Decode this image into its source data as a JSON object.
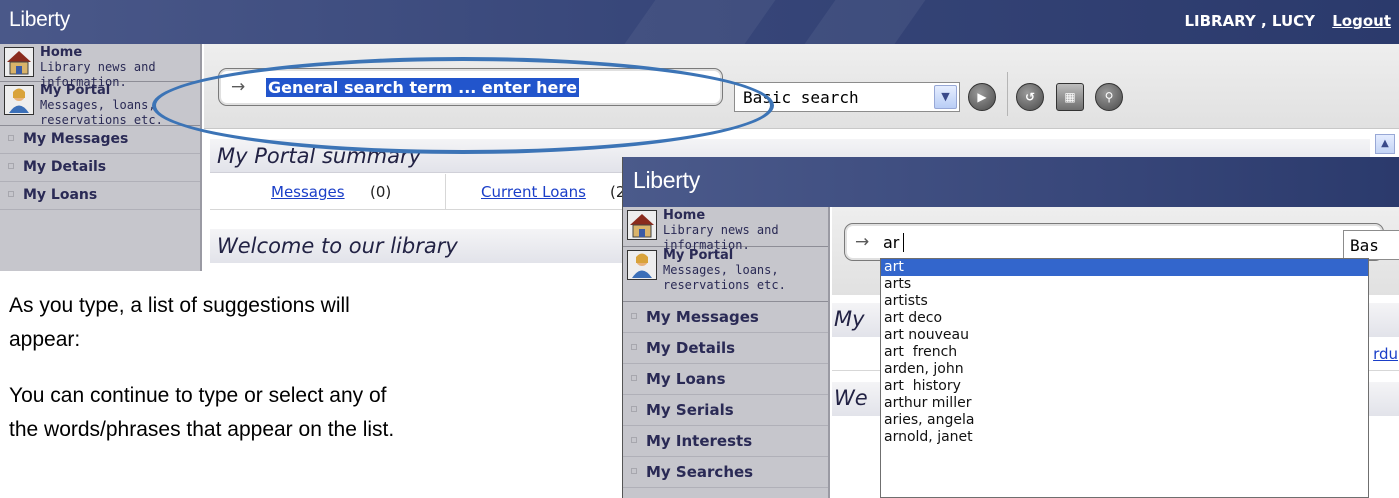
{
  "screenshot1": {
    "app_name": "Liberty",
    "user_name": "LIBRARY , LUCY",
    "logout_label": "Logout",
    "nav": {
      "home_title": "Home",
      "home_desc": "Library news and information.",
      "portal_title": "My Portal",
      "portal_desc": "Messages, loans, reservations etc.",
      "items": [
        "My Messages",
        "My Details",
        "My Loans"
      ]
    },
    "search": {
      "arrow": "→",
      "value": "General search term ... enter here",
      "search_type": "Basic search"
    },
    "toolbar_icons": [
      "go-button",
      "reset-button",
      "clear-button",
      "zoom-button"
    ],
    "summary_title": "My Portal summary",
    "summary_links": [
      {
        "label": "Messages",
        "count": "(0)"
      },
      {
        "label": "Current Loans",
        "count": "(2"
      }
    ],
    "welcome_title": "Welcome to our library"
  },
  "instructions": {
    "line1": "As you type, a list of suggestions will",
    "line2": "appear:",
    "line3": "You can continue to type or select any of",
    "line4": "the words/phrases that appear on the list."
  },
  "screenshot2": {
    "app_name": "Liberty",
    "nav": {
      "home_title": "Home",
      "home_desc": "Library news and information.",
      "portal_title": "My Portal",
      "portal_desc": "Messages, loans, reservations etc.",
      "items": [
        "My Messages",
        "My Details",
        "My Loans",
        "My Serials",
        "My Interests",
        "My Searches"
      ]
    },
    "search": {
      "arrow": "→",
      "value": "ar",
      "search_type_partial": "Bas"
    },
    "content_partial": {
      "heading1": "My",
      "link_partial": "rdu",
      "heading2": "We"
    },
    "suggestions": [
      "art",
      "arts",
      "artists",
      "art deco",
      "art nouveau",
      "art  french",
      "arden, john",
      "art  history",
      "arthur miller",
      "aries, angela",
      "arnold, janet"
    ],
    "selected_suggestion": "art"
  },
  "colors": {
    "header": "#38477a",
    "nav_bg": "#c6c6cc",
    "highlight": "#2255cc",
    "annotation_ellipse": "#3c74b6",
    "link": "#1a3ec8"
  }
}
